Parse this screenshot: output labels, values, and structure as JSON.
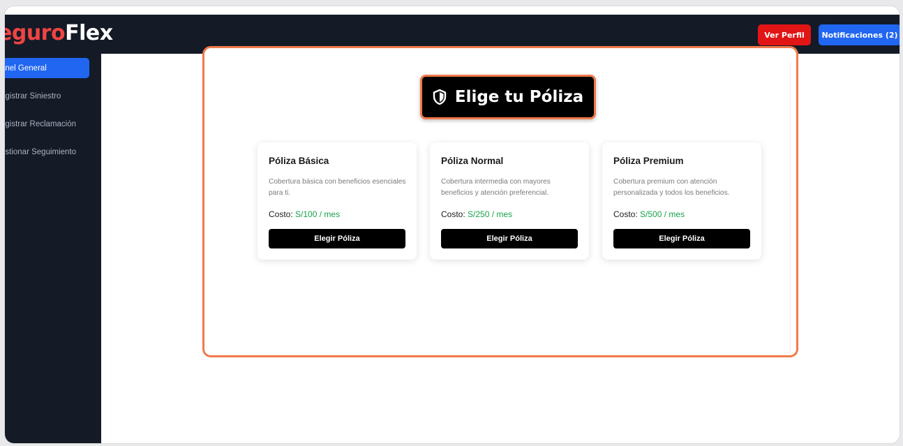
{
  "header": {
    "brand_prefix": "eguro",
    "brand_suffix": "Flex",
    "profile_button": "Ver Perfil",
    "notifications_button": "Notificaciones (2)"
  },
  "sidebar": {
    "items": [
      {
        "label": "anel General",
        "active": true
      },
      {
        "label": "egistrar Siniestro",
        "active": false
      },
      {
        "label": "egistrar Reclamación",
        "active": false
      },
      {
        "label": "estionar Seguimiento",
        "active": false
      }
    ]
  },
  "main": {
    "title": "Elige tu Póliza",
    "title_icon": "shield-icon",
    "policies": [
      {
        "name": "Póliza Básica",
        "description": "Cobertura básica con beneficios esenciales para ti.",
        "cost_label": "Costo:",
        "price": "S/100 / mes",
        "button": "Elegir Póliza"
      },
      {
        "name": "Póliza Normal",
        "description": "Cobertura intermedia con mayores beneficios y atención preferencial.",
        "cost_label": "Costo:",
        "price": "S/250 / mes",
        "button": "Elegir Póliza"
      },
      {
        "name": "Póliza Premium",
        "description": "Cobertura premium con atención personalizada y todos los beneficios.",
        "cost_label": "Costo:",
        "price": "S/500 / mes",
        "button": "Elegir Póliza"
      }
    ]
  },
  "colors": {
    "nav_bg": "#141a26",
    "brand_red": "#ef4444",
    "profile_red": "#e11515",
    "accent_blue": "#2166f0",
    "highlight_orange": "#f07a4a",
    "price_green": "#16a34a"
  }
}
